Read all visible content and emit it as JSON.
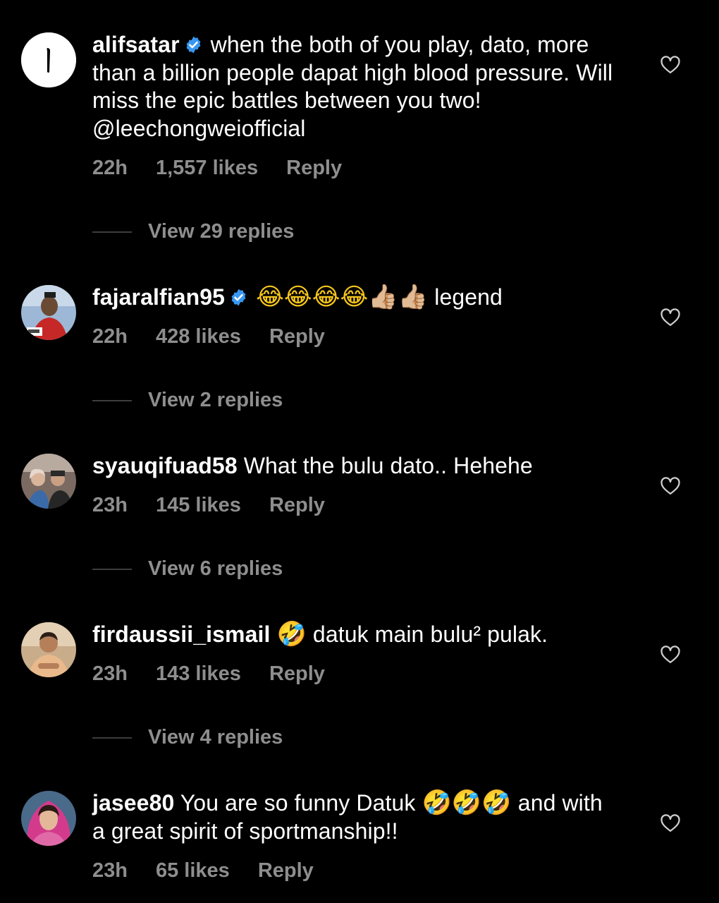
{
  "comments": [
    {
      "username": "alifsatar",
      "verified": true,
      "text": "when the both of you play, dato, more than a billion people dapat high blood pressure. Will miss the epic battles between you two! @leechongweiofficial",
      "time": "22h",
      "likes": "1,557 likes",
      "reply": "Reply",
      "view_replies": "View 29 replies",
      "avatar_icon": "letter-logo-avatar"
    },
    {
      "username": "fajaralfian95",
      "verified": true,
      "emoji": "😂😂😂😂👍🏼👍🏼",
      "text": "legend",
      "time": "22h",
      "likes": "428 likes",
      "reply": "Reply",
      "view_replies": "View 2 replies",
      "avatar_icon": "athlete-photo-avatar"
    },
    {
      "username": "syauqifuad58",
      "verified": false,
      "text": "What the bulu dato.. Hehehe",
      "time": "23h",
      "likes": "145 likes",
      "reply": "Reply",
      "view_replies": "View 6 replies",
      "avatar_icon": "family-photo-avatar"
    },
    {
      "username": "firdaussii_ismail",
      "verified": false,
      "emoji": "🤣",
      "text": "datuk main bulu² pulak.",
      "time": "23h",
      "likes": "143 likes",
      "reply": "Reply",
      "view_replies": "View 4 replies",
      "avatar_icon": "man-photo-avatar"
    },
    {
      "username": "jasee80",
      "verified": false,
      "text_before": "You are so funny Datuk",
      "emoji": "🤣🤣🤣",
      "text": "and with a great spirit of sportmanship!!",
      "time": "23h",
      "likes": "65 likes",
      "reply": "Reply",
      "avatar_icon": "woman-photo-avatar"
    }
  ],
  "colors": {
    "background": "#000000",
    "text": "#ffffff",
    "meta": "#8e8e8e",
    "verified": "#3897f0"
  },
  "icons": {
    "like": "heart-outline-icon",
    "verified": "verified-badge-icon"
  }
}
